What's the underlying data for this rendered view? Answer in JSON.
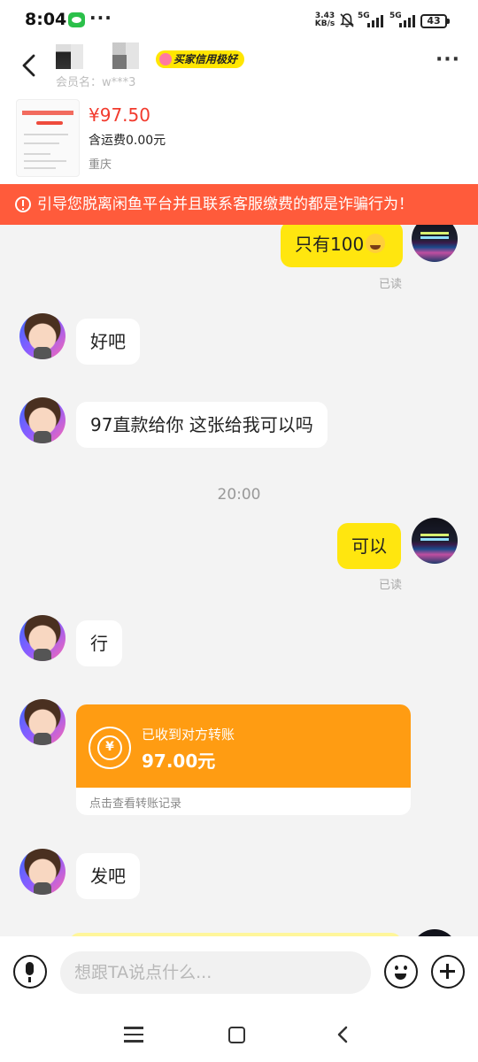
{
  "status_bar": {
    "time": "8:04",
    "dots": "···",
    "net_speed_value": "3.43",
    "net_speed_unit": "KB/s",
    "sim1_label": "5G",
    "sim2_label": "5G",
    "battery": "43"
  },
  "header": {
    "credit_badge": "买家信用极好",
    "member_name": "会员名：w***3"
  },
  "product": {
    "price": "¥97.50",
    "shipping": "含运费0.00元",
    "location": "重庆"
  },
  "warning": {
    "text": "引导您脱离闲鱼平台并且联系客服缴费的都是诈骗行为！"
  },
  "messages": [
    {
      "side": "out",
      "text": "只有100",
      "emoji": "crying-face-icon",
      "read": "已读"
    },
    {
      "side": "in",
      "text": "好吧"
    },
    {
      "side": "in",
      "text": "97直款给你 这张给我可以吗"
    },
    {
      "side": "out",
      "text": "可以",
      "read": "已读"
    },
    {
      "side": "in",
      "text": "行"
    },
    {
      "side": "in",
      "text": "发吧"
    }
  ],
  "time_divider": "20:00",
  "transfer": {
    "title": "已收到对方转账",
    "amount": "97.00元",
    "footer": "点击查看转账记录",
    "icon_symbol": "¥"
  },
  "input": {
    "placeholder": "想跟TA说点什么..."
  },
  "colors": {
    "accent_yellow": "#ffe60f",
    "warning_red": "#ff5b3b",
    "price_red": "#f23b2e",
    "transfer_orange": "#ff9c12"
  }
}
